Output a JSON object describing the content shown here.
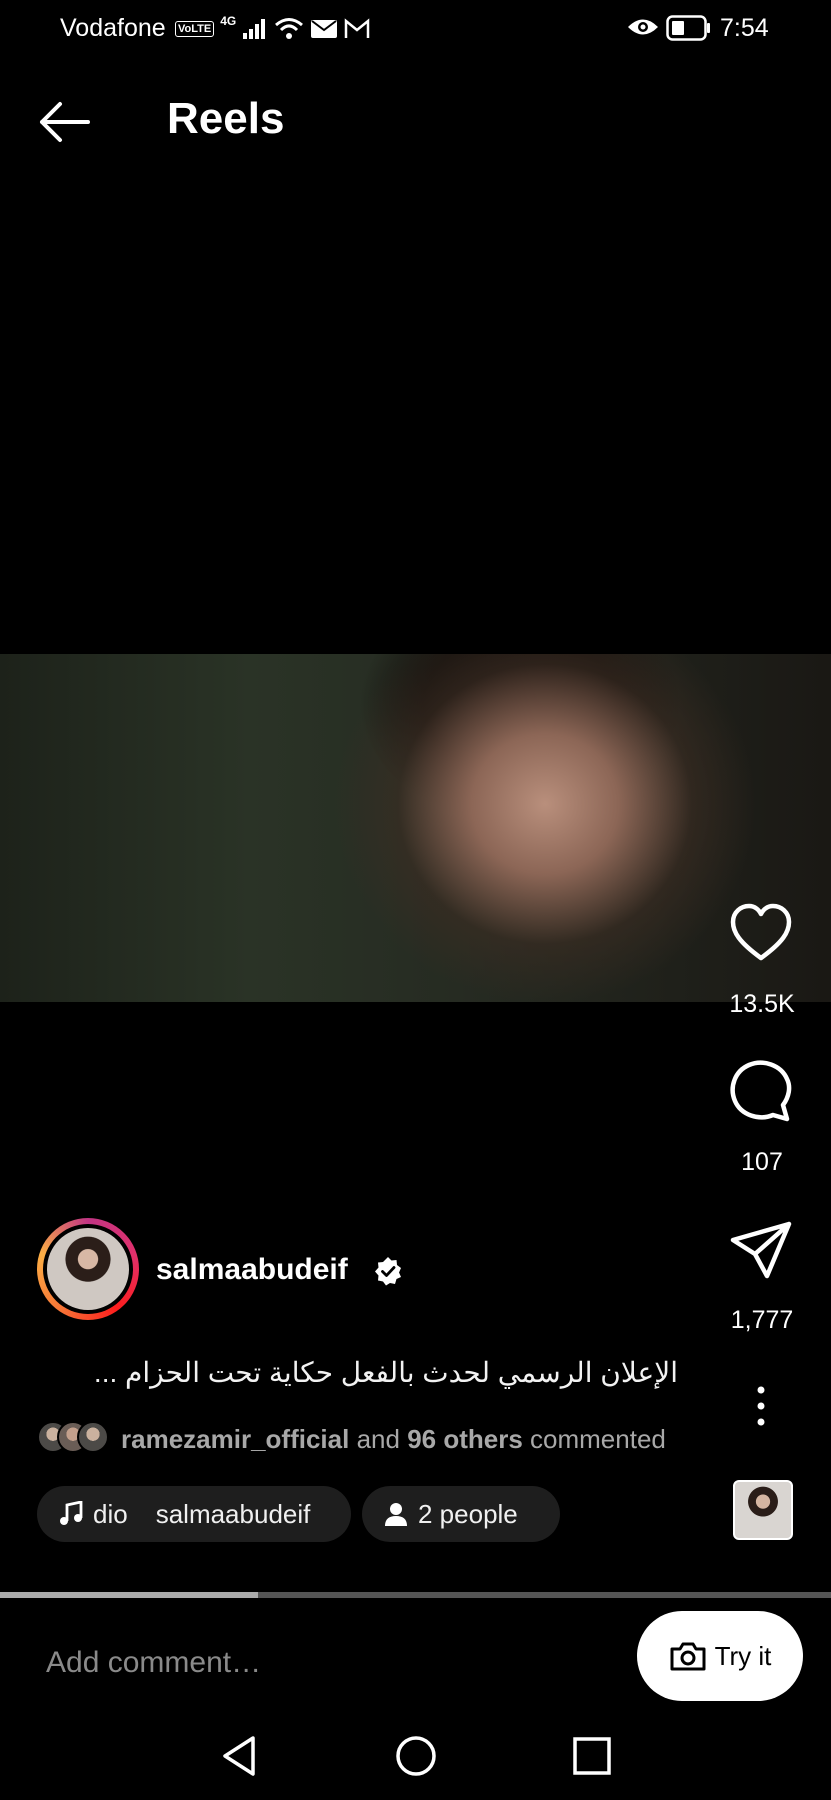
{
  "status_bar": {
    "carrier": "Vodafone",
    "volte": "VoLTE",
    "network": "4G",
    "time": "7:54"
  },
  "header": {
    "title": "Reels",
    "back_icon": "arrow-left-icon"
  },
  "reel": {
    "progress_percent": 31,
    "likes": "13.5K",
    "comments": "107",
    "shares": "1,777"
  },
  "author": {
    "username": "salmaabudeif",
    "verified": true
  },
  "caption": "الإعلان الرسمي لحدث بالفعل حكاية تحت الحزام ...",
  "comment_summary": {
    "user": "ramezamir_official",
    "and": "and",
    "others": "96 others",
    "suffix": "commented"
  },
  "audio": {
    "track": "dio",
    "artist": "salmaabudeif"
  },
  "tagged": {
    "label": "2 people"
  },
  "comment_input": {
    "placeholder": "Add comment…"
  },
  "try_it": {
    "label": "Try it"
  },
  "colors": {
    "background": "#000000",
    "pill": "#1e1e1e",
    "muted": "#a8a8a8"
  }
}
